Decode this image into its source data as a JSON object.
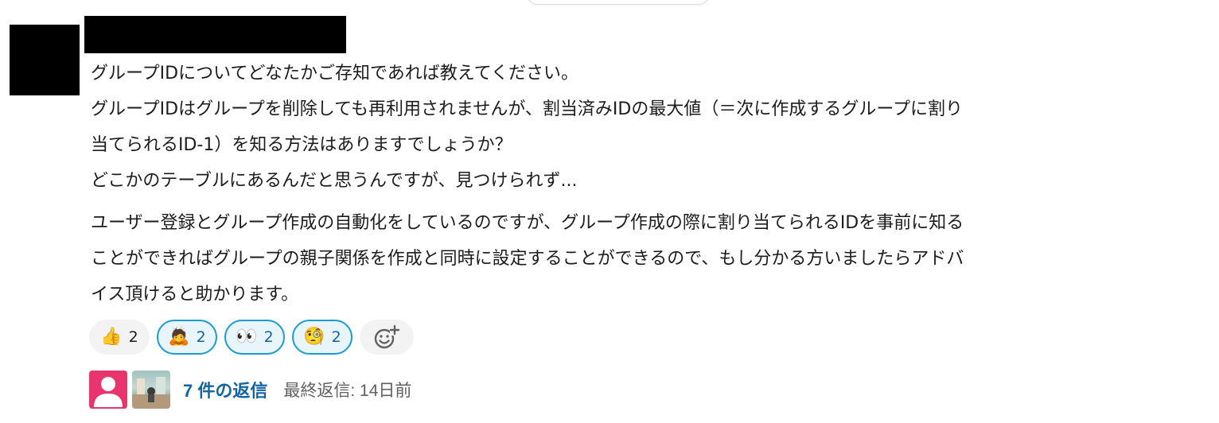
{
  "message": {
    "author": "",
    "lines_para1": [
      "グループIDについてどなたかご存知であれば教えてください。",
      "グループIDはグループを削除しても再利用されませんが、割当済みIDの最大値（＝次に作成するグループに割り",
      "当てられるID-1）を知る方法はありますでしょうか？",
      "どこかのテーブルにあるんだと思うんですが、見つけられず..."
    ],
    "lines_para2": [
      "ユーザー登録とグループ作成の自動化をしているのですが、グループ作成の際に割り当てられるIDを事前に知る",
      "ことができればグループの親子関係を作成と同時に設定することができるので、もし分かる方いましたらアドバ",
      "イス頂けると助かります。"
    ]
  },
  "reactions": [
    {
      "emoji": "👍",
      "icon": "thumbs-up-icon",
      "count": "2",
      "active": false
    },
    {
      "emoji": "🙇",
      "icon": "bowing-person-icon",
      "count": "2",
      "active": true
    },
    {
      "emoji": "👀",
      "icon": "eyes-icon",
      "count": "2",
      "active": true
    },
    {
      "emoji": "🧐",
      "icon": "monocle-face-icon",
      "count": "2",
      "active": true
    }
  ],
  "add_reaction_icon": "add-emoji-icon",
  "thread": {
    "reply_count": "7 件の返信",
    "last_reply": "最終返信: 14日前"
  },
  "colors": {
    "link": "#1264a3",
    "reaction_active_border": "#1d9bd1",
    "reaction_active_bg": "#e8f5fa",
    "default_avatar_bg": "#e8356d"
  }
}
